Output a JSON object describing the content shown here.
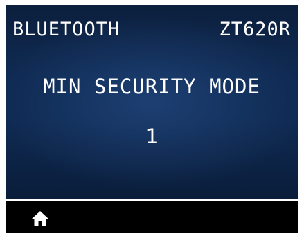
{
  "header": {
    "menu_title": "BLUETOOTH",
    "printer_model": "ZT620R"
  },
  "setting": {
    "name": "MIN SECURITY MODE",
    "value": "1"
  },
  "footer": {
    "home_icon": "home-icon"
  },
  "colors": {
    "screen_background": "#0f2a52",
    "text": "#ffffff",
    "bezel": "#000000"
  }
}
